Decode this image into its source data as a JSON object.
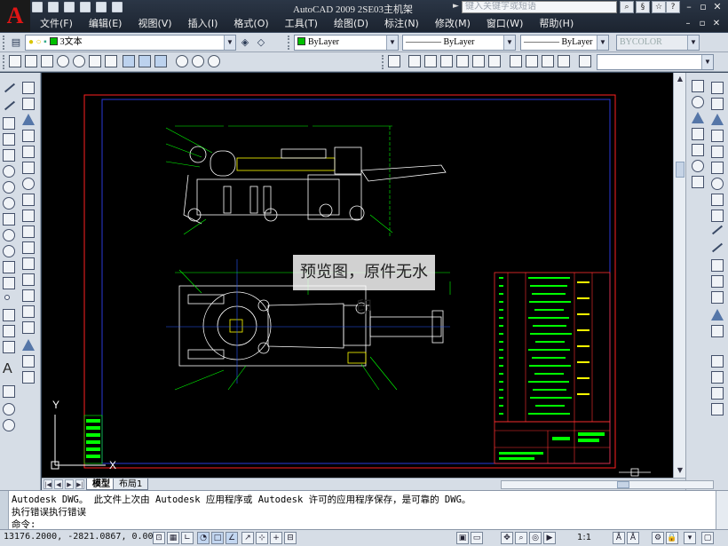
{
  "app": {
    "window_title": "AutoCAD 2009  2SE03主机架",
    "help_search_placeholder": "键入关键字或短语",
    "logo_letter": "A"
  },
  "menu": {
    "items": [
      "文件(F)",
      "编辑(E)",
      "视图(V)",
      "插入(I)",
      "格式(O)",
      "工具(T)",
      "绘图(D)",
      "标注(N)",
      "修改(M)",
      "窗口(W)",
      "帮助(H)"
    ]
  },
  "toolbar": {
    "layer_value": "3文本",
    "color_value": "ByLayer",
    "linetype_value": "———— ByLayer",
    "lineweight_value": "———— ByLayer",
    "plotstyle_value": "BYCOLOR"
  },
  "canvas": {
    "ucs_y_label": "Y",
    "ucs_x_label": "X",
    "background": "#000000",
    "frame_color": "#ff0000",
    "inner_frame_color": "#2233cc",
    "drawing_color": "#00ff00",
    "accent_color": "#ffff00"
  },
  "watermark": {
    "text": "预览图，原件无水印"
  },
  "layout_tabs": {
    "items": [
      "模型",
      "布局1"
    ],
    "active": "模型"
  },
  "command": {
    "line1": "Autodesk DWG。  此文件上次由 Autodesk 应用程序或 Autodesk 许可的应用程序保存，是可靠的 DWG。",
    "line2": "执行错误执行错误",
    "prompt": "命令:"
  },
  "status": {
    "coordinates": "13176.2000, -2821.0867, 0.0000",
    "annotation_scale": "1:1"
  }
}
